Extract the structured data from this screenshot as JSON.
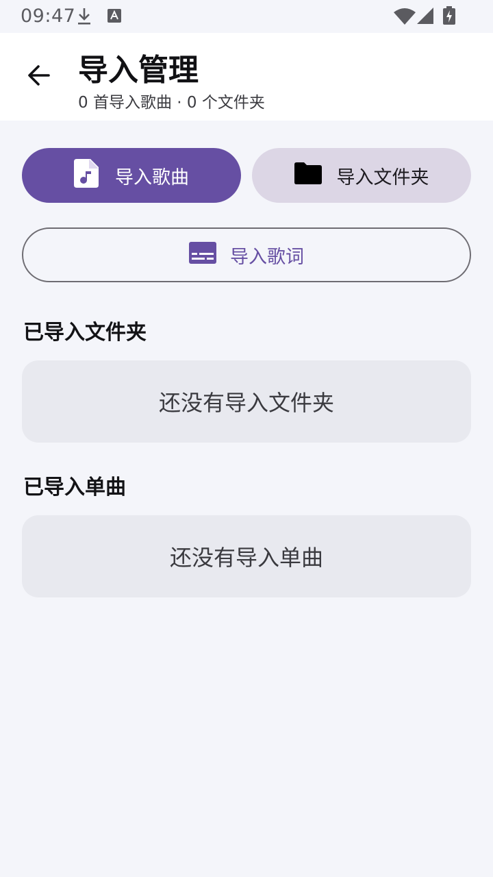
{
  "status_bar": {
    "time": "09:47",
    "icons": [
      "download-icon",
      "keyboard-a-icon",
      "wifi-icon",
      "signal-icon",
      "battery-charging-icon"
    ]
  },
  "app_bar": {
    "title": "导入管理",
    "subtitle": "0 首导入歌曲 · 0 个文件夹",
    "back_icon": "arrow-back-icon"
  },
  "actions": {
    "import_songs": {
      "label": "导入歌曲",
      "icon": "music-file-icon"
    },
    "import_folder": {
      "label": "导入文件夹",
      "icon": "folder-icon"
    },
    "import_lyrics": {
      "label": "导入歌词",
      "icon": "subtitles-icon"
    }
  },
  "sections": {
    "folders": {
      "title": "已导入文件夹",
      "empty_text": "还没有导入文件夹"
    },
    "songs": {
      "title": "已导入单曲",
      "empty_text": "还没有导入单曲"
    }
  },
  "colors": {
    "primary": "#664fa3",
    "tonal": "#dcd6e5",
    "background": "#f4f5fa",
    "card": "#e8e9ef"
  }
}
